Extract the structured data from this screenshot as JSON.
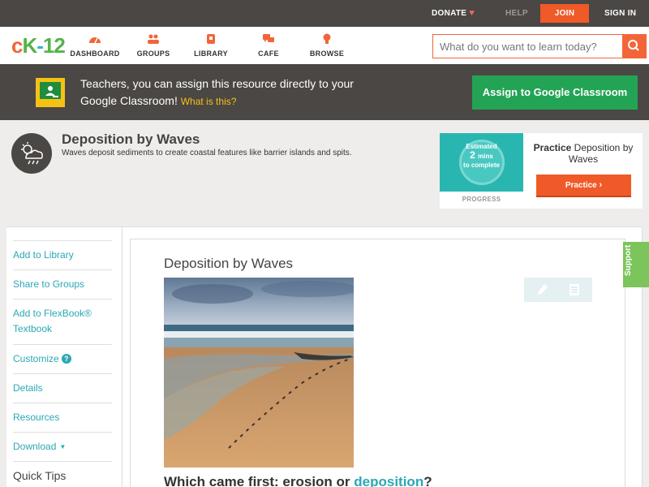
{
  "topbar": {
    "donate": "DONATE",
    "help": "HELP",
    "join": "JOIN",
    "signin": "SIGN IN"
  },
  "nav": {
    "logo": {
      "c": "c",
      "k": "K",
      "dash": "-",
      "num": "12"
    },
    "items": [
      {
        "label": "DASHBOARD",
        "icon": "dashboard-icon"
      },
      {
        "label": "GROUPS",
        "icon": "groups-icon"
      },
      {
        "label": "LIBRARY",
        "icon": "library-icon"
      },
      {
        "label": "CAFE",
        "icon": "cafe-icon"
      },
      {
        "label": "BROWSE",
        "icon": "browse-icon"
      }
    ],
    "search_placeholder": "What do you want to learn today?"
  },
  "classroom": {
    "text": "Teachers, you can assign this resource directly to your Google Classroom!",
    "what": "What is this?",
    "button": "Assign to Google Classroom"
  },
  "concept": {
    "title": "Deposition by Waves",
    "description": "Waves deposit sediments to create coastal features like barrier islands and spits."
  },
  "practice": {
    "estimated": "Estimated",
    "mins_value": "2",
    "mins_unit": "mins",
    "to_complete": "to complete",
    "progress": "PROGRESS",
    "title_bold": "Practice",
    "title_rest": "Deposition by Waves",
    "button": "Practice"
  },
  "sidebar": {
    "links": [
      "Add to Library",
      "Share to Groups",
      "Add to FlexBook® Textbook",
      "Customize",
      "Details",
      "Resources",
      "Download",
      "Quick Tips"
    ]
  },
  "content": {
    "title": "Deposition by Waves",
    "question_pre": "Which came first: erosion or ",
    "question_kw": "deposition",
    "question_post": "?"
  },
  "support": "Support",
  "colors": {
    "brand_orange": "#f05a28",
    "teal_link": "#2aa8b5",
    "classroom_green": "#23a455",
    "dark_bar": "#4a4744"
  }
}
